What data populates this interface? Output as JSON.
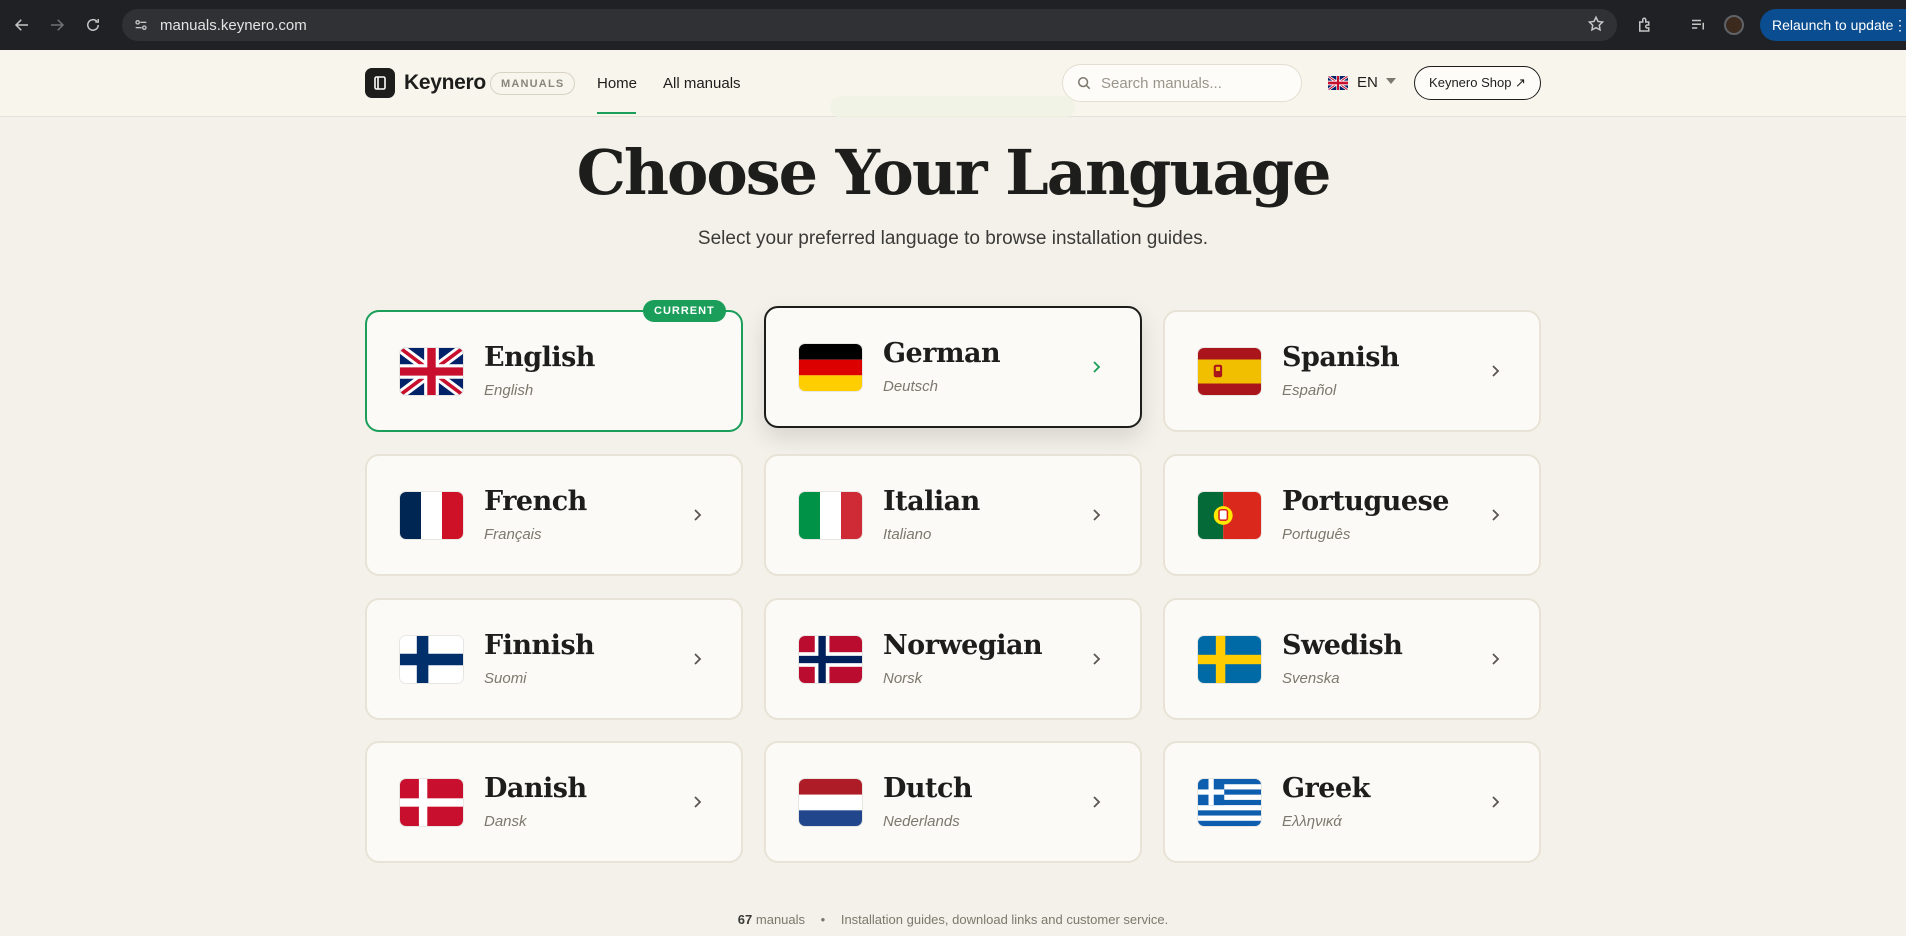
{
  "browser": {
    "url": "manuals.keynero.com",
    "relaunch_label": "Relaunch to update"
  },
  "header": {
    "brand": "Keynero",
    "badge": "MANUALS",
    "nav_home": "Home",
    "nav_all": "All manuals",
    "search_placeholder": "Search manuals...",
    "lang_code": "EN",
    "shop_label": "Keynero Shop ↗"
  },
  "hero": {
    "title": "Choose Your Language",
    "subtitle": "Select your preferred language to browse installation guides."
  },
  "current_badge": "CURRENT",
  "languages": [
    {
      "name": "English",
      "native": "English",
      "flag": "uk-flag-icon",
      "state": "current"
    },
    {
      "name": "German",
      "native": "Deutsch",
      "flag": "germany-flag-icon",
      "state": "hover"
    },
    {
      "name": "Spanish",
      "native": "Español",
      "flag": "spain-flag-icon",
      "state": "normal"
    },
    {
      "name": "French",
      "native": "Français",
      "flag": "france-flag-icon",
      "state": "normal"
    },
    {
      "name": "Italian",
      "native": "Italiano",
      "flag": "italy-flag-icon",
      "state": "normal"
    },
    {
      "name": "Portuguese",
      "native": "Português",
      "flag": "portugal-flag-icon",
      "state": "normal"
    },
    {
      "name": "Finnish",
      "native": "Suomi",
      "flag": "finland-flag-icon",
      "state": "normal"
    },
    {
      "name": "Norwegian",
      "native": "Norsk",
      "flag": "norway-flag-icon",
      "state": "normal"
    },
    {
      "name": "Swedish",
      "native": "Svenska",
      "flag": "sweden-flag-icon",
      "state": "normal"
    },
    {
      "name": "Danish",
      "native": "Dansk",
      "flag": "denmark-flag-icon",
      "state": "normal"
    },
    {
      "name": "Dutch",
      "native": "Nederlands",
      "flag": "netherlands-flag-icon",
      "state": "normal"
    },
    {
      "name": "Greek",
      "native": "Ελληνικά",
      "flag": "greece-flag-icon",
      "state": "normal"
    }
  ],
  "footer": {
    "count": "67",
    "count_label": "manuals",
    "separator": "•",
    "text": "Installation guides, download links and customer service."
  },
  "colors": {
    "accent_green": "#1a9e5a",
    "background": "#f3f1e9",
    "text_dark": "#1d1d1b"
  }
}
